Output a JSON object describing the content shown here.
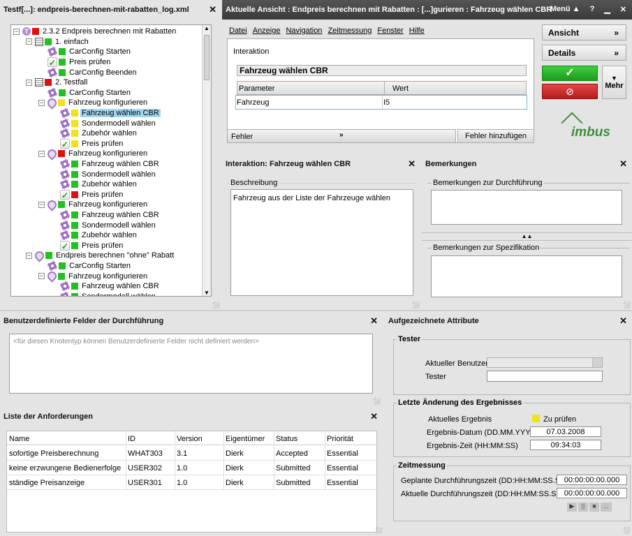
{
  "left_panel": {
    "title": "Testf[...]: endpreis-berechnen-mit-rabatten_log.xml",
    "tree": [
      {
        "label": "2.3.2 Endpreis berechnen mit Rabatten",
        "status": "r",
        "kind": "root"
      },
      {
        "label": "1. einfach",
        "status": "g",
        "kind": "doc"
      },
      {
        "label": "CarConfig Starten",
        "status": "g",
        "kind": "gear"
      },
      {
        "label": "Preis prüfen",
        "status": "g",
        "kind": "check"
      },
      {
        "label": "CarConfig Beenden",
        "status": "g",
        "kind": "gear"
      },
      {
        "label": "2. Testfall",
        "status": "r",
        "kind": "doc"
      },
      {
        "label": "CarConfig Starten",
        "status": "g",
        "kind": "gear"
      },
      {
        "label": "Fahrzeug konfigurieren",
        "status": "y",
        "kind": "drop"
      },
      {
        "label": "Fahrzeug wählen CBR",
        "status": "y",
        "kind": "gear",
        "selected": true
      },
      {
        "label": "Sondermodell wählen",
        "status": "y",
        "kind": "gear"
      },
      {
        "label": "Zubehör wählen",
        "status": "y",
        "kind": "gear"
      },
      {
        "label": "Preis prüfen",
        "status": "y",
        "kind": "check"
      },
      {
        "label": "Fahrzeug konfigurieren",
        "status": "r",
        "kind": "drop"
      },
      {
        "label": "Fahrzeug wählen CBR",
        "status": "g",
        "kind": "gear"
      },
      {
        "label": "Sondermodell wählen",
        "status": "g",
        "kind": "gear"
      },
      {
        "label": "Zubehör wählen",
        "status": "g",
        "kind": "gear"
      },
      {
        "label": "Preis prüfen",
        "status": "r",
        "kind": "check"
      },
      {
        "label": "Fahrzeug konfigurieren",
        "status": "g",
        "kind": "drop"
      },
      {
        "label": "Fahrzeug wählen CBR",
        "status": "g",
        "kind": "gear"
      },
      {
        "label": "Sondermodell wählen",
        "status": "g",
        "kind": "gear"
      },
      {
        "label": "Zubehör wählen",
        "status": "g",
        "kind": "gear"
      },
      {
        "label": "Preis prüfen",
        "status": "g",
        "kind": "check"
      },
      {
        "label": "Endpreis berechnen \"ohne\" Rabatt",
        "status": "g",
        "kind": "drop"
      },
      {
        "label": "CarConfig Starten",
        "status": "g",
        "kind": "gear"
      },
      {
        "label": "Fahrzeug konfigurieren",
        "status": "g",
        "kind": "drop"
      },
      {
        "label": "Fahrzeug wählen CBR",
        "status": "g",
        "kind": "gear"
      },
      {
        "label": "Sondermodell wählen",
        "status": "g",
        "kind": "gear"
      }
    ]
  },
  "main_window": {
    "title": "Aktuelle Ansicht : Endpreis berechnen mit Rabatten : [...]gurieren : Fahrzeug wählen CBR",
    "menu_label": "Menü",
    "help": "?",
    "menu": [
      "Datei",
      "Anzeige",
      "Navigation",
      "Zeitmessung",
      "Fenster",
      "Hilfe"
    ],
    "section_label": "Interaktion",
    "interaction_name": "Fahrzeug wählen CBR",
    "param_headers": [
      "Parameter",
      "Wert"
    ],
    "params": [
      {
        "name": "Fahrzeug",
        "value": "I5"
      }
    ],
    "fehler_label": "Fehler",
    "fehler_add": "Fehler hinzufügen",
    "btn_ansicht": "Ansicht",
    "btn_details": "Details",
    "btn_mehr": "Mehr",
    "logo": "imbus"
  },
  "interaction_panel": {
    "title": "Interaktion: Fahrzeug wählen CBR",
    "desc_label": "Beschreibung",
    "desc_text": "Fahrzeug aus der Liste der Fahrzeuge wählen"
  },
  "remarks_panel": {
    "title": "Bemerkungen",
    "exec_label": "Bemerkungen zur Durchführung",
    "spec_label": "Bemerkungen zur Spezifikation"
  },
  "custom_fields": {
    "title": "Benutzerdefinierte Felder der Durchführung",
    "placeholder": "<für diesen Knotentyp können Benutzerdefinierte Felder nicht definiert werden>"
  },
  "requirements": {
    "title": "Liste der Anforderungen",
    "headers": [
      "Name",
      "ID",
      "Version",
      "Eigentümer",
      "Status",
      "Priorität"
    ],
    "rows": [
      [
        "sofortige Preisberechnung",
        "WHAT303",
        "3.1",
        "Dierk",
        "Accepted",
        "Essential"
      ],
      [
        "keine erzwungene Bedienerfolge",
        "USER302",
        "1.0",
        "Dierk",
        "Submitted",
        "Essential"
      ],
      [
        "ständige Preisanzeige",
        "USER301",
        "1.0",
        "Dierk",
        "Submitted",
        "Essential"
      ]
    ]
  },
  "attributes": {
    "title": "Aufgezeichnete Attribute",
    "tester_group": "Tester",
    "current_user_label": "Aktueller Benutzer",
    "tester_label": "Tester",
    "result_group": "Letzte Änderung des Ergebnisses",
    "current_result_label": "Aktuelles Ergebnis",
    "current_result_value": "Zu prüfen",
    "date_label": "Ergebnis-Datum (DD.MM.YYYY)",
    "date_value": "07.03.2008",
    "time_label": "Ergebnis-Zeit (HH:MM:SS)",
    "time_value": "09:34:03",
    "timing_group": "Zeitmessung",
    "planned_label": "Geplante Durchführungszeit (DD:HH:MM:SS.SSS)",
    "planned_value": "00:00:00:00.000",
    "actual_label": "Aktuelle Durchführungszeit (DD:HH:MM:SS.SSS)",
    "actual_value": "00:00:00:00.000"
  }
}
